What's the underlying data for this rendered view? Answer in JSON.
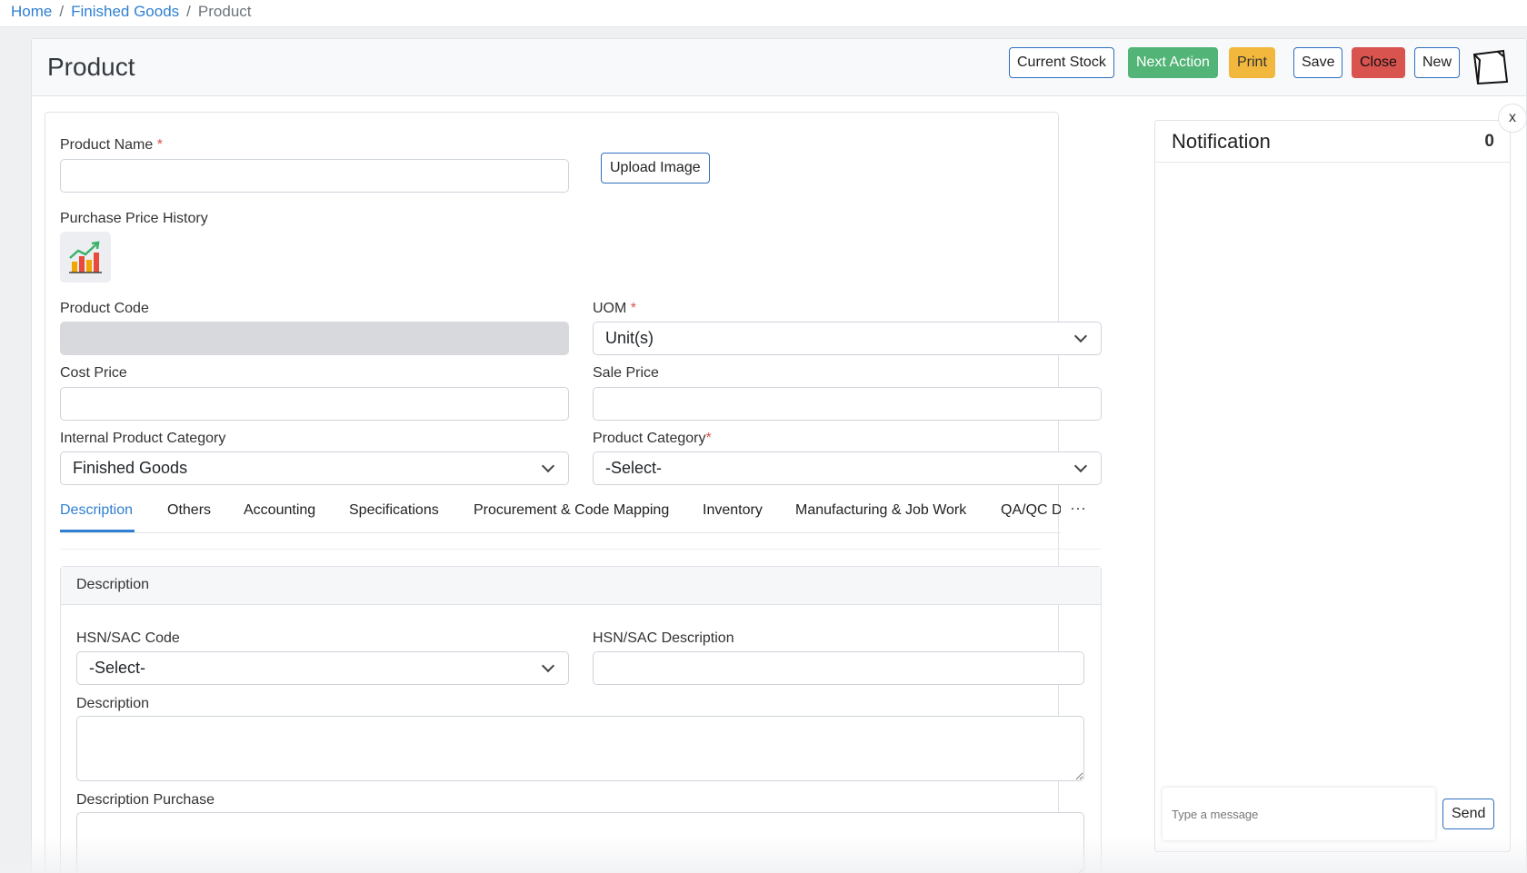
{
  "breadcrumb": {
    "home": "Home",
    "section": "Finished Goods",
    "current": "Product",
    "sep1": "/",
    "sep2": "/"
  },
  "header": {
    "title": "Product",
    "buttons": {
      "current_stock": "Current Stock",
      "next_action": "Next Action",
      "print": "Print",
      "save": "Save",
      "close": "Close",
      "new": "New"
    }
  },
  "form": {
    "product_name_label": "Product Name",
    "product_name_value": "",
    "required_mark": "*",
    "upload_image": "Upload Image",
    "purchase_price_history": "Purchase Price History",
    "product_code_label": "Product Code",
    "product_code_value": "",
    "uom_label": "UOM",
    "uom_value": "Unit(s)",
    "cost_price_label": "Cost Price",
    "cost_price_value": "",
    "sale_price_label": "Sale Price",
    "sale_price_value": "",
    "internal_category_label": "Internal Product Category",
    "internal_category_value": "Finished Goods",
    "product_category_label": "Product Category",
    "product_category_value": "-Select-"
  },
  "tabs": [
    {
      "label": "Description"
    },
    {
      "label": "Others"
    },
    {
      "label": "Accounting"
    },
    {
      "label": "Specifications"
    },
    {
      "label": "Procurement & Code Mapping"
    },
    {
      "label": "Inventory"
    },
    {
      "label": "Manufacturing & Job Work"
    },
    {
      "label": "QA/QC Details"
    }
  ],
  "tab_more": "···",
  "description_section": {
    "title": "Description",
    "hsn_code_label": "HSN/SAC Code",
    "hsn_code_value": "-Select-",
    "hsn_desc_label": "HSN/SAC Description",
    "hsn_desc_value": "",
    "description_label": "Description",
    "description_value": "",
    "description_purchase_label": "Description Purchase",
    "description_purchase_value": ""
  },
  "notification": {
    "title": "Notification",
    "count": "0",
    "close": "x",
    "message_placeholder": "Type a message",
    "send": "Send"
  },
  "icons": {
    "chart": "chart-growth-icon",
    "note": "sticky-note-icon",
    "dropdown": "chevron-down-icon"
  },
  "colors": {
    "primary": "#2f80d1",
    "success": "#52b476",
    "warning": "#f1b83d",
    "danger": "#d9534f"
  }
}
